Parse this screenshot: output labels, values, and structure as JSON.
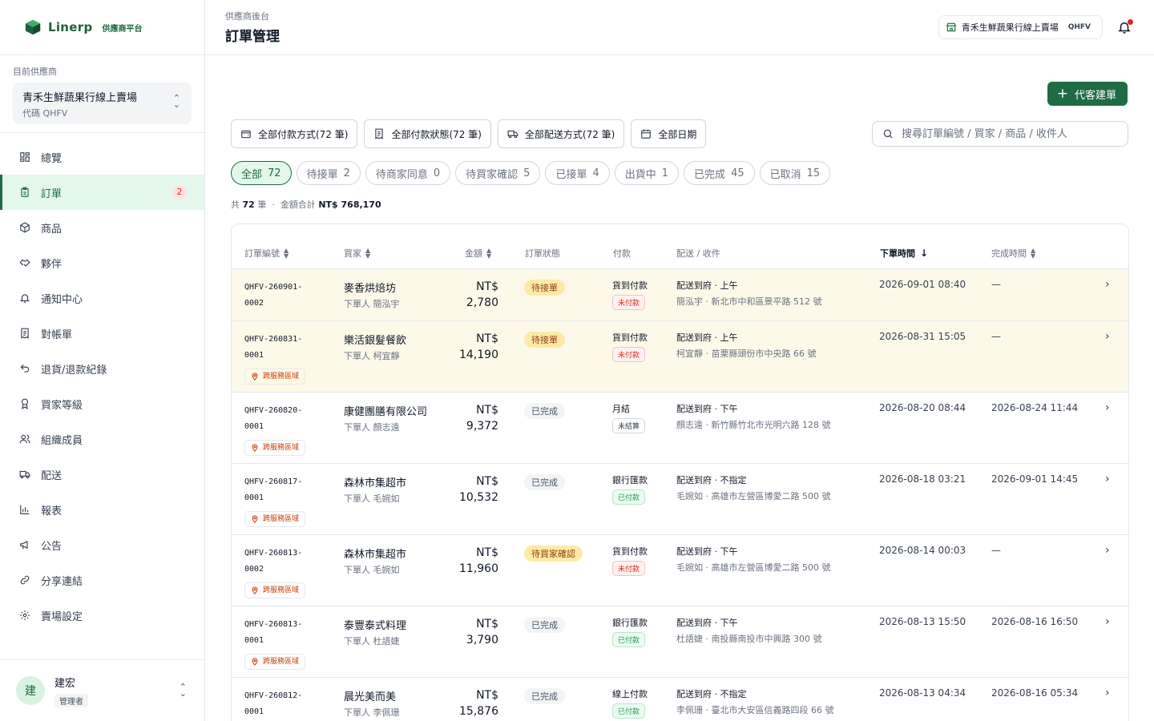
{
  "brand": {
    "name": "Linerp",
    "sub": "供應商平台"
  },
  "supplier": {
    "label": "目前供應商",
    "name": "青禾生鮮蔬果行線上賣場",
    "code": "代碼 QHFV"
  },
  "nav": [
    {
      "label": "總覽",
      "icon": "dashboard-icon"
    },
    {
      "label": "訂單",
      "icon": "clipboard-icon",
      "badge": "2",
      "active": true
    },
    {
      "label": "商品",
      "icon": "box-icon"
    },
    {
      "label": "夥伴",
      "icon": "handshake-icon"
    },
    {
      "label": "通知中心",
      "icon": "bell-icon"
    },
    {
      "label": "對帳單",
      "icon": "receipt-icon"
    },
    {
      "label": "退貨/退款紀錄",
      "icon": "undo-icon"
    },
    {
      "label": "買家等級",
      "icon": "award-icon"
    },
    {
      "label": "組織成員",
      "icon": "users-icon"
    },
    {
      "label": "配送",
      "icon": "truck-icon"
    },
    {
      "label": "報表",
      "icon": "bar-chart-icon"
    },
    {
      "label": "公告",
      "icon": "megaphone-icon"
    },
    {
      "label": "分享連結",
      "icon": "link-icon"
    },
    {
      "label": "賣場設定",
      "icon": "settings-icon"
    }
  ],
  "user": {
    "avatar": "建",
    "name": "建宏",
    "role": "管理者"
  },
  "header": {
    "crumb": "供應商後台",
    "title": "訂單管理",
    "store": "青禾生鮮蔬果行線上賣場",
    "store_code": "QHFV"
  },
  "actions": {
    "new_order": "代客建單"
  },
  "filters": [
    {
      "label": "全部付款方式(72 筆)",
      "icon": "wallet-icon"
    },
    {
      "label": "全部付款狀態(72 筆)",
      "icon": "receipt-icon"
    },
    {
      "label": "全部配送方式(72 筆)",
      "icon": "truck-icon"
    },
    {
      "label": "全部日期",
      "icon": "calendar-icon"
    }
  ],
  "search": {
    "placeholder": "搜尋訂單編號 / 買家 / 商品 / 收件人"
  },
  "tabs": [
    {
      "label": "全部",
      "count": "72",
      "active": true
    },
    {
      "label": "待接單",
      "count": "2"
    },
    {
      "label": "待商家同意",
      "count": "0"
    },
    {
      "label": "待買家確認",
      "count": "5"
    },
    {
      "label": "已接單",
      "count": "4"
    },
    {
      "label": "出貨中",
      "count": "1"
    },
    {
      "label": "已完成",
      "count": "45"
    },
    {
      "label": "已取消",
      "count": "15"
    }
  ],
  "summary": {
    "prefix": "共",
    "count": "72",
    "unit": "筆",
    "sep": "·",
    "amount_label": "金額合計",
    "amount": "NT$ 768,170"
  },
  "columns": {
    "order_id": "訂單編號",
    "buyer": "買家",
    "amount": "金額",
    "status": "訂單狀態",
    "payment": "付款",
    "delivery": "配送 / 收件",
    "created": "下單時間",
    "completed": "完成時間"
  },
  "cross_tag": "跨服務區域",
  "orders": [
    {
      "id1": "QHFV-260901-",
      "id2": "0002",
      "cross": false,
      "buyer": "麥香烘焙坊",
      "placer": "下單人 簡泓宇",
      "currency": "NT$",
      "amount": "2,780",
      "status": "待接單",
      "status_kind": "warn",
      "pay": "貨到付款",
      "pay_status": "未付款",
      "pay_kind": "unpaid",
      "delivery": "配送到府 · 上午",
      "address": "簡泓宇 · 新北市中和區景平路 512 號",
      "created": "2026-09-01 08:40",
      "completed": "—",
      "highlight": true
    },
    {
      "id1": "QHFV-260831-",
      "id2": "0001",
      "cross": true,
      "buyer": "樂活銀髮餐飲",
      "placer": "下單人 柯宜靜",
      "currency": "NT$",
      "amount": "14,190",
      "status": "待接單",
      "status_kind": "warn",
      "pay": "貨到付款",
      "pay_status": "未付款",
      "pay_kind": "unpaid",
      "delivery": "配送到府 · 上午",
      "address": "柯宜靜 · 苗栗縣頭份市中央路 66 號",
      "created": "2026-08-31 15:05",
      "completed": "—",
      "highlight": true
    },
    {
      "id1": "QHFV-260820-",
      "id2": "0001",
      "cross": true,
      "buyer": "康健團膳有限公司",
      "placer": "下單人 顏志遠",
      "currency": "NT$",
      "amount": "9,372",
      "status": "已完成",
      "status_kind": "done",
      "pay": "月結",
      "pay_status": "未結算",
      "pay_kind": "unsettled",
      "delivery": "配送到府 · 下午",
      "address": "顏志遠 · 新竹縣竹北市光明六路 128 號",
      "created": "2026-08-20 08:44",
      "completed": "2026-08-24 11:44",
      "highlight": false
    },
    {
      "id1": "QHFV-260817-",
      "id2": "0001",
      "cross": true,
      "buyer": "森林市集超市",
      "placer": "下單人 毛婉如",
      "currency": "NT$",
      "amount": "10,532",
      "status": "已完成",
      "status_kind": "done",
      "pay": "銀行匯款",
      "pay_status": "已付款",
      "pay_kind": "paid",
      "delivery": "配送到府 · 不指定",
      "address": "毛婉如 · 高雄市左營區博愛二路 500 號",
      "created": "2026-08-18 03:21",
      "completed": "2026-09-01 14:45",
      "highlight": false
    },
    {
      "id1": "QHFV-260813-",
      "id2": "0002",
      "cross": true,
      "buyer": "森林市集超市",
      "placer": "下單人 毛婉如",
      "currency": "NT$",
      "amount": "11,960",
      "status": "待買家確認",
      "status_kind": "warn",
      "pay": "貨到付款",
      "pay_status": "未付款",
      "pay_kind": "unpaid",
      "delivery": "配送到府 · 下午",
      "address": "毛婉如 · 高雄市左營區博愛二路 500 號",
      "created": "2026-08-14 00:03",
      "completed": "—",
      "highlight": false
    },
    {
      "id1": "QHFV-260813-",
      "id2": "0001",
      "cross": true,
      "buyer": "泰豐泰式料理",
      "placer": "下單人 杜語婕",
      "currency": "NT$",
      "amount": "3,790",
      "status": "已完成",
      "status_kind": "done",
      "pay": "銀行匯款",
      "pay_status": "已付款",
      "pay_kind": "paid",
      "delivery": "配送到府 · 下午",
      "address": "杜語婕 · 南投縣南投市中興路 300 號",
      "created": "2026-08-13 15:50",
      "completed": "2026-08-16 16:50",
      "highlight": false
    },
    {
      "id1": "QHFV-260812-",
      "id2": "0001",
      "cross": false,
      "buyer": "晨光美而美",
      "placer": "下單人 李佩珊",
      "currency": "NT$",
      "amount": "15,876",
      "status": "已完成",
      "status_kind": "done",
      "pay": "線上付款",
      "pay_status": "已付款",
      "pay_kind": "paid",
      "delivery": "配送到府 · 不指定",
      "address": "李佩珊 · 臺北市大安區信義路四段 66 號",
      "created": "2026-08-13 04:34",
      "completed": "2026-08-16 05:34",
      "highlight": false
    }
  ],
  "colors": {
    "accent": "#1f6b44",
    "accent_light": "#e3f7ea",
    "danger": "#d92d20",
    "highlight_row": "#fdf9e8"
  }
}
